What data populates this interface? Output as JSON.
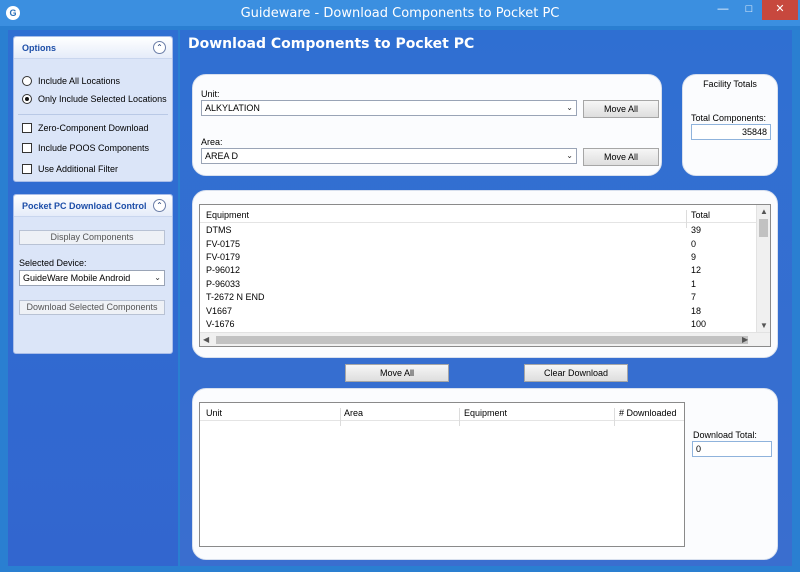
{
  "window": {
    "title": "Guideware - Download Components to Pocket PC",
    "app_icon": "G",
    "minimize_glyph": "—",
    "maximize_glyph": "□",
    "close_glyph": "✕"
  },
  "options": {
    "title": "Options",
    "collapse_glyph": "⌃",
    "include_all": "Include All Locations",
    "only_selected": "Only Include Selected Locations",
    "zero_component": "Zero-Component Download",
    "include_poos": "Include POOS Components",
    "additional_filter": "Use Additional Filter",
    "selected_radio": "only_selected"
  },
  "pocket": {
    "title": "Pocket PC Download Control",
    "collapse_glyph": "⌃",
    "display_button": "Display Components",
    "device_label": "Selected Device:",
    "device_value": "GuideWare Mobile Android",
    "download_button": "Download Selected Components"
  },
  "main": {
    "title": "Download Components to Pocket PC",
    "unit_label": "Unit:",
    "unit_value": "ALKYLATION",
    "area_label": "Area:",
    "area_value": "AREA D",
    "move_all": "Move All",
    "facility_title": "Facility Totals",
    "total_components_label": "Total Components:",
    "total_components_value": "35848",
    "move_all_center": "Move All",
    "clear_download": "Clear Download",
    "download_total_label": "Download Total:",
    "download_total_value": "0"
  },
  "equipment_table": {
    "headers": [
      "Equipment",
      "Total"
    ],
    "rows": [
      [
        "DTMS",
        "39"
      ],
      [
        "FV-0175",
        "0"
      ],
      [
        "FV-0179",
        "9"
      ],
      [
        "P-96012",
        "12"
      ],
      [
        "P-96033",
        "1"
      ],
      [
        "T-2672 N END",
        "7"
      ],
      [
        "V1667",
        "18"
      ],
      [
        "V-1676",
        "100"
      ]
    ]
  },
  "download_table": {
    "headers": [
      "Unit",
      "Area",
      "Equipment",
      "# Downloaded"
    ]
  },
  "glyphs": {
    "chevron_down": "⌄",
    "arrow_up": "▲",
    "arrow_down": "▼",
    "arrow_left": "◀",
    "arrow_right": "▶"
  }
}
